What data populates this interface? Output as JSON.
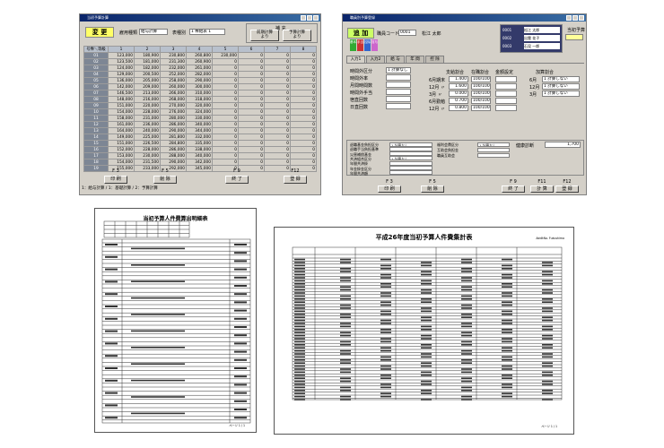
{
  "win1": {
    "title": "当初予算計算",
    "mode_badge": "変 更",
    "labels": {
      "employ_type": "雇用種類",
      "table_type": "表種別"
    },
    "selects": {
      "budget": "給与計算",
      "table": "1 棒給表 1"
    },
    "side_box_title": "補 充",
    "buttons": {
      "prev_year": "前期計算\nより",
      "budget": "予算計算\nより"
    },
    "grid_headers": [
      "号俸＼等級",
      "1",
      "2",
      "3",
      "4",
      "5",
      "6",
      "7",
      "8"
    ],
    "rows": [
      [
        "01",
        "123,000",
        "180,900",
        "230,800",
        "260,800",
        "230,000",
        "0",
        "0",
        "0"
      ],
      [
        "02",
        "123,500",
        "181,000",
        "231,300",
        "260,900",
        "0",
        "0",
        "0",
        "0"
      ],
      [
        "03",
        "124,000",
        "182,000",
        "232,000",
        "261,000",
        "0",
        "0",
        "0",
        "0"
      ],
      [
        "04",
        "129,000",
        "200,500",
        "252,000",
        "282,000",
        "0",
        "0",
        "0",
        "0"
      ],
      [
        "05",
        "136,000",
        "205,000",
        "258,000",
        "290,000",
        "0",
        "0",
        "0",
        "0"
      ],
      [
        "06",
        "142,000",
        "209,000",
        "260,000",
        "300,000",
        "0",
        "0",
        "0",
        "0"
      ],
      [
        "07",
        "146,500",
        "213,000",
        "266,000",
        "310,000",
        "0",
        "0",
        "0",
        "0"
      ],
      [
        "08",
        "148,000",
        "216,000",
        "268,000",
        "318,000",
        "0",
        "0",
        "0",
        "0"
      ],
      [
        "09",
        "151,000",
        "220,000",
        "270,000",
        "320,000",
        "0",
        "0",
        "0",
        "0"
      ],
      [
        "10",
        "154,000",
        "228,000",
        "276,000",
        "324,000",
        "0",
        "0",
        "0",
        "0"
      ],
      [
        "11",
        "158,000",
        "231,000",
        "280,000",
        "330,000",
        "0",
        "0",
        "0",
        "0"
      ],
      [
        "12",
        "161,000",
        "236,000",
        "286,000",
        "340,000",
        "0",
        "0",
        "0",
        "0"
      ],
      [
        "13",
        "164,000",
        "240,000",
        "290,000",
        "344,000",
        "0",
        "0",
        "0",
        "0"
      ],
      [
        "14",
        "149,000",
        "225,000",
        "281,800",
        "332,000",
        "0",
        "0",
        "0",
        "0"
      ],
      [
        "15",
        "151,000",
        "226,500",
        "284,800",
        "335,000",
        "0",
        "0",
        "0",
        "0"
      ],
      [
        "16",
        "152,000",
        "228,000",
        "286,000",
        "338,000",
        "0",
        "0",
        "0",
        "0"
      ],
      [
        "17",
        "153,000",
        "230,000",
        "288,000",
        "340,000",
        "0",
        "0",
        "0",
        "0"
      ],
      [
        "18",
        "154,000",
        "231,500",
        "290,000",
        "342,000",
        "0",
        "0",
        "0",
        "0"
      ],
      [
        "19",
        "155,000",
        "233,000",
        "292,000",
        "345,000",
        "0",
        "0",
        "0",
        "0"
      ]
    ],
    "fkeys": [
      {
        "key": "F 3",
        "label": "印 刷"
      },
      {
        "key": "F 5",
        "label": "削 除"
      },
      {
        "key": "F 9",
        "label": "終 了"
      },
      {
        "key": "F12",
        "label": "登 録"
      }
    ],
    "status": "1：給与計算 / 1：基礎計算 / 2：予算計算"
  },
  "win2": {
    "title": "職員別予算登録",
    "mode_badge": "追 加",
    "emp_code_label": "職員コード",
    "emp_code": "0001",
    "emp_name": "松江 太郎",
    "tabs": [
      "入力1",
      "入力2",
      "給 与",
      "年 間",
      "控 除"
    ],
    "radio_labels": [
      "基本",
      "手当",
      "控除",
      "賞与"
    ],
    "info_rows": [
      "0001",
      "0002",
      "0003"
    ],
    "info_values": [
      "松江 太郎",
      "出雲 花子",
      "石見 一郎"
    ],
    "right_label": "当初予算",
    "left_items": [
      "時間外区分",
      "時間外率",
      "月間時間数",
      "時間外手当",
      "宿直回数",
      "日直回数"
    ],
    "left_first_val": "1 計算なし",
    "col_headers": [
      "支給割合",
      "在職割合",
      "金額設定",
      "加算割合"
    ],
    "mid_rows": [
      {
        "label": "6月期末",
        "v1": "1.400",
        "v2": "100/100"
      },
      {
        "label": "12月 〃",
        "v1": "1.600",
        "v2": "100/100"
      },
      {
        "label": "3月 〃",
        "v1": "0.000",
        "v2": "100/100"
      },
      {
        "label": "6月勤勉",
        "v1": "0.700",
        "v2": "100/100"
      },
      {
        "label": "12月 〃",
        "v1": "0.800",
        "v2": "100/100"
      }
    ],
    "add_rows": [
      {
        "label": "6月",
        "value": "1 計算しない"
      },
      {
        "label": "12月",
        "value": "1 計算しない"
      },
      {
        "label": "3月",
        "value": "1 計算しない"
      }
    ],
    "bottom_left": [
      "退職基金負担区分",
      "退職手当負担基準",
      "災害補償基金",
      "共済組合区分",
      "年間共済掛",
      "年金掛金区分",
      "年間共済額"
    ],
    "bottom_mid": [
      "福利会費区分",
      "互助会負担金",
      "職員互助会"
    ],
    "bottom_right_label": "健康診断",
    "bottom_right_value": "1,700",
    "no_calc": "1 計算なし",
    "fkeys": [
      {
        "key": "F 3",
        "label": "印 刷"
      },
      {
        "key": "F 5",
        "label": "削 除"
      },
      {
        "key": "F 9",
        "label": "終 了"
      },
      {
        "key": "F11",
        "label": "計 算"
      },
      {
        "key": "F12",
        "label": "登 録"
      }
    ]
  },
  "paper1": {
    "title": "当初予算人件費算出明細表",
    "footer": "ページ 1 / 1"
  },
  "paper2": {
    "title": "平成26年度当初予算人件費集計表",
    "header_right": "AdditNo. Fukushima",
    "footer": "ページ 1 / 1"
  }
}
